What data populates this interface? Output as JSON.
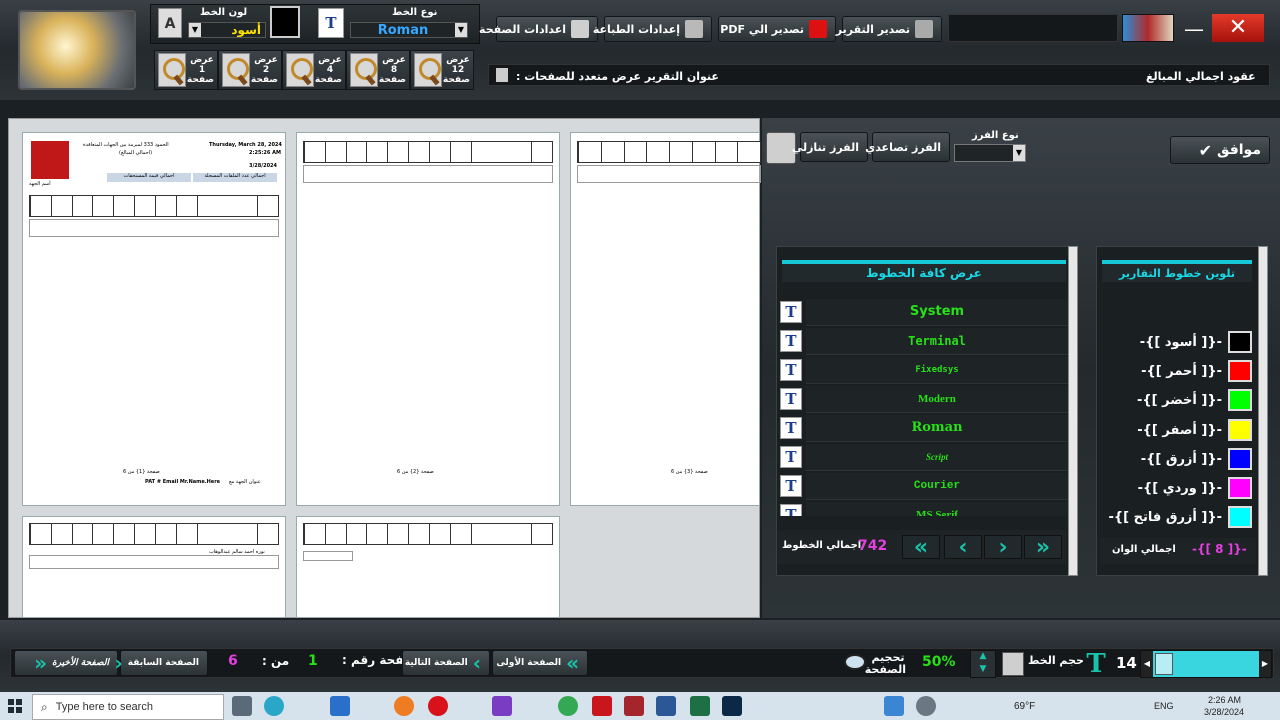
{
  "top": {
    "font_color_label": "لون الخط",
    "font_color_value": "أسود",
    "font_type_label": "نوع الخط",
    "font_type_value": "Roman",
    "buttons": {
      "page_settings": "اعدادات الصفحة",
      "print_settings": "إعدادات الطباعة",
      "export_pdf": "تصدير الي PDF",
      "export_report": "تصدير التقرير"
    },
    "zoom": [
      {
        "line1": "عرض",
        "line2": "1",
        "line3": "صفحة"
      },
      {
        "line1": "عرض",
        "line2": "2",
        "line3": "صفحة"
      },
      {
        "line1": "عرض",
        "line2": "4",
        "line3": "صفحة"
      },
      {
        "line1": "عرض",
        "line2": "8",
        "line3": "صفحة"
      },
      {
        "line1": "عرض",
        "line2": "12",
        "line3": "صفحة"
      }
    ],
    "report_title_label": "عنوان التقرير عرض متعدد للصفحات :",
    "report_name": "عقود اجمالي المبالغ"
  },
  "sort": {
    "sort_type_label": "نوع الفرز",
    "ascending": "الفرز تصاعدي",
    "descending": "الفرز تنازلي",
    "ok": "موافق"
  },
  "fonts_panel": {
    "title": "عرض كافة الخطوط",
    "fonts": [
      "System",
      "Terminal",
      "Fixedsys",
      "Modern",
      "Roman",
      "Script",
      "Courier",
      "MS Serif"
    ],
    "total_label": "اجمالي الخطوط",
    "total_value": "742"
  },
  "colors_panel": {
    "title": "تلوين خطوط التقارير",
    "colors": [
      {
        "label": "-{[ أسود ]}-",
        "hex": "#000000"
      },
      {
        "label": "-{[ أحمر ]}-",
        "hex": "#ff0000"
      },
      {
        "label": "-{[ أخضر ]}-",
        "hex": "#00ff00"
      },
      {
        "label": "-{[ أصفر ]}-",
        "hex": "#ffff00"
      },
      {
        "label": "-{[ أزرق ]}-",
        "hex": "#0000ff"
      },
      {
        "label": "-{[ وردي ]}-",
        "hex": "#ff00ff"
      },
      {
        "label": "-{[ أزرق فاتح ]}-",
        "hex": "#00ffff"
      }
    ],
    "total_label": "اجمالي الوان",
    "total_value": "-{[ 8 ]}-"
  },
  "report_pages": {
    "page1": {
      "header_line1": "الحمود 333 لمبرمة بين الجهات المتعاقدة",
      "header_line2": "(اجمالي المبالغ)",
      "date_line": "Thursday, March 28, 2024",
      "time_line": "2:25:26 AM",
      "short_date": "3/28/2024",
      "label_files": "اجمالي عدد الملفات المسجلة",
      "label_value": "اجمالي قيمة المستحقات",
      "entity_label": "أسم الجهة",
      "footer": "صفحة {1} من 6",
      "footer2": "عنوان الجهة مع",
      "footer3": "PAT # Email   Mr.Name.Here"
    },
    "page2_footer": "صفحة {2} من 6",
    "page3_footer": "صفحة {3} من 6",
    "page4_text": "نوره احمد سالم عبدالوهاب"
  },
  "bottom_nav": {
    "last_page": "الصفحة الأخيرة",
    "prev_page": "الصفحة السابقة",
    "total_pages": "6",
    "of_label": "من :",
    "current_page": "1",
    "page_num_label": "صفحة رقم :",
    "next_page": "الصفحة التالية",
    "first_page": "الصفحة الأولى",
    "page_zoom_label": "تحجيم الصفحة",
    "zoom_value": "50%",
    "font_size_label": "حجم الخط",
    "font_size_value": "14"
  },
  "taskbar": {
    "search_placeholder": "Type here to search",
    "weather": "69°F",
    "lang": "ENG",
    "time": "2:26 AM",
    "date": "3/28/2024"
  }
}
